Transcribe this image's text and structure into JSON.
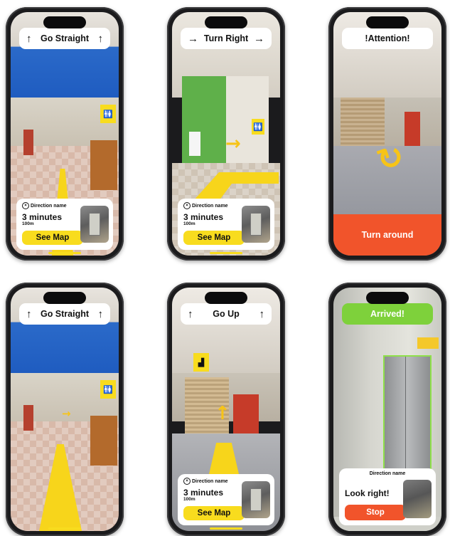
{
  "phones": [
    {
      "id": "p1",
      "banner_text": "Go Straight",
      "left_arrow": "↑",
      "right_arrow": "↑",
      "card": {
        "direction_label": "Direction name",
        "minutes": "3 minutes",
        "distance": "100m",
        "button": "See Map"
      }
    },
    {
      "id": "p2",
      "banner_text": "Turn Right",
      "left_arrow": "→",
      "right_arrow": "→",
      "card": {
        "direction_label": "Direction name",
        "minutes": "3 minutes",
        "distance": "100m",
        "button": "See Map"
      }
    },
    {
      "id": "p3",
      "banner_text": "!Attention!",
      "bottom_button": "Turn around"
    },
    {
      "id": "p4",
      "banner_text": "Go Straight",
      "left_arrow": "↑",
      "right_arrow": "↑"
    },
    {
      "id": "p5",
      "banner_text": "Go Up",
      "left_arrow": "↑",
      "right_arrow": "↑",
      "card": {
        "direction_label": "Direction name",
        "minutes": "3 minutes",
        "distance": "100m",
        "button": "See Map"
      }
    },
    {
      "id": "p6",
      "banner_text": "Arrived!",
      "card": {
        "direction_label": "Direction name",
        "message": "Look right!",
        "button": "Stop"
      }
    }
  ],
  "icons": {
    "close": "×",
    "restroom": "🚻",
    "stairs": "▟"
  },
  "colors": {
    "accent_yellow": "#f8dc1e",
    "alert_orange": "#f1542b",
    "success_green": "#7ed13b",
    "phone_frame": "#1b1b1d"
  }
}
